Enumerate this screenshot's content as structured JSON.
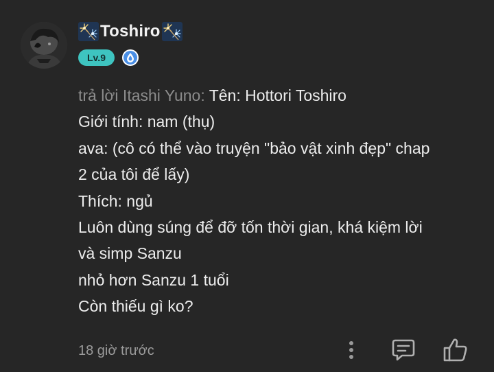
{
  "user": {
    "name": "Toshiro",
    "level": "Lv.9",
    "decoration_icon": "sparkler-fireworks-icon"
  },
  "comment": {
    "reply_prefix": "trả lời Itashi Yuno:",
    "lines": [
      "Tên: Hottori Toshiro",
      "Giới tính: nam (thụ)",
      "ava: (cô có thể vào truyện \"bảo vật xinh đẹp\" chap",
      "2 của tôi để lấy)",
      "Thích: ngủ",
      "Luôn dùng súng để đỡ tốn thời gian, khá kiệm lời",
      "và simp Sanzu",
      "nhỏ hơn Sanzu 1 tuổi",
      "Còn thiếu gì ko?"
    ]
  },
  "footer": {
    "timestamp": "18 giờ trước"
  },
  "colors": {
    "background": "#262626",
    "level_badge": "#3ec4c0",
    "drop_badge": "#4a8fe6",
    "muted_text": "#8c8c8c"
  }
}
